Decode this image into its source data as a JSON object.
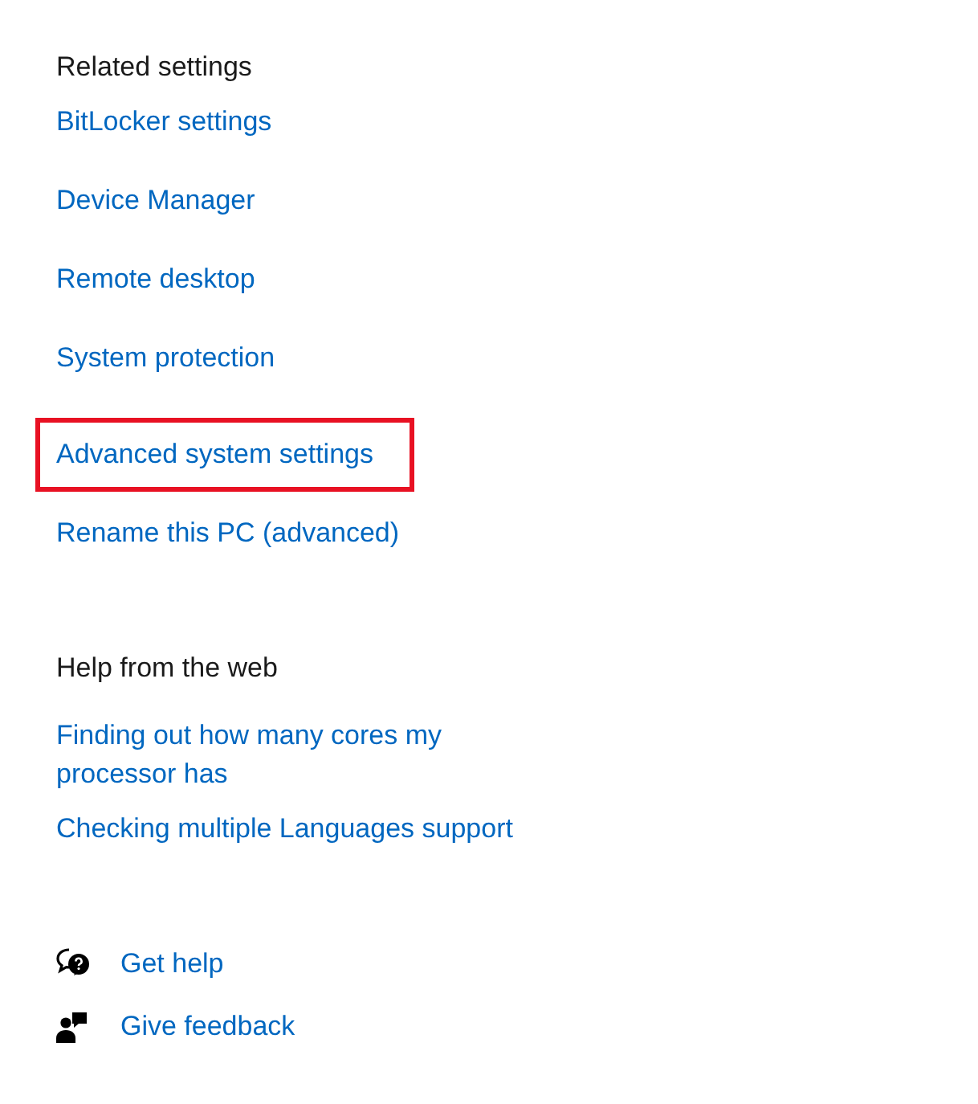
{
  "related_settings": {
    "heading": "Related settings",
    "links": [
      {
        "label": "BitLocker settings",
        "highlighted": false
      },
      {
        "label": "Device Manager",
        "highlighted": false
      },
      {
        "label": "Remote desktop",
        "highlighted": false
      },
      {
        "label": "System protection",
        "highlighted": false
      },
      {
        "label": "Advanced system settings",
        "highlighted": true
      },
      {
        "label": "Rename this PC (advanced)",
        "highlighted": false
      }
    ]
  },
  "help_from_the_web": {
    "heading": "Help from the web",
    "links": [
      {
        "label": "Finding out how many cores my processor has"
      },
      {
        "label": "Checking multiple Languages support"
      }
    ]
  },
  "actions": [
    {
      "kind": "help",
      "label": "Get help"
    },
    {
      "kind": "feedback",
      "label": "Give feedback"
    }
  ]
}
